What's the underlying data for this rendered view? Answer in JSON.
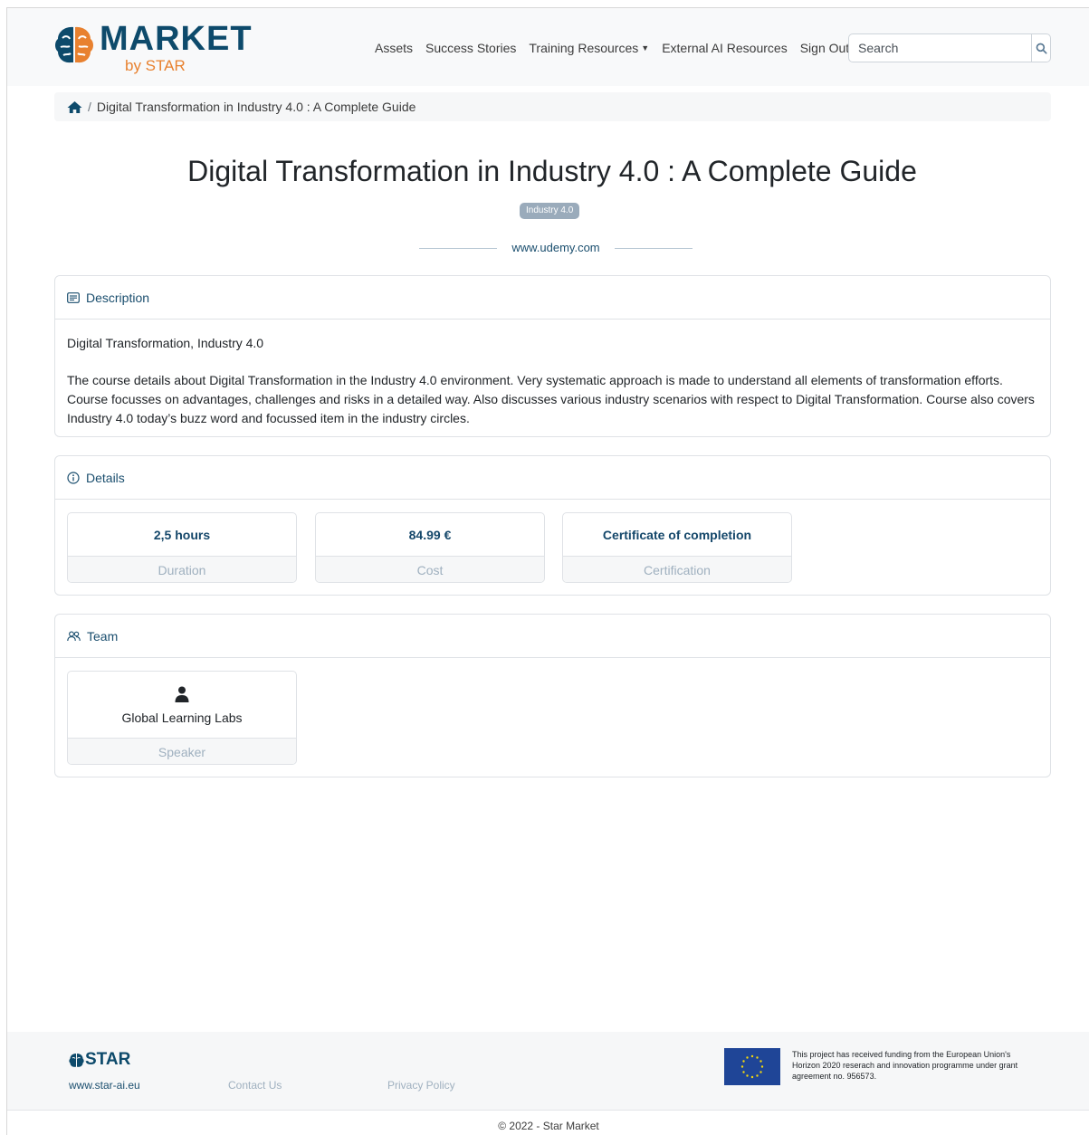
{
  "brand": {
    "logo_word": "MARKET",
    "logo_sub": "by STAR",
    "primary_color": "#0d4a6b",
    "accent_color": "#e8812f",
    "logo_icon": "brain-logo-icon"
  },
  "nav": {
    "items": [
      {
        "label": "Assets"
      },
      {
        "label": "Success Stories"
      },
      {
        "label": "Training Resources",
        "dropdown": true
      },
      {
        "label": "External AI Resources"
      },
      {
        "label": "Sign Out"
      }
    ],
    "search_placeholder": "Search",
    "search_icon": "search-icon"
  },
  "breadcrumb": {
    "home_icon": "home-icon",
    "separator": "/",
    "current": "Digital Transformation in Industry 4.0 : A Complete Guide"
  },
  "asset": {
    "title": "Digital Transformation in Industry 4.0 : A Complete Guide",
    "tag": "Industry 4.0",
    "source": "www.udemy.com"
  },
  "description": {
    "header": "Description",
    "keywords": "Digital Transformation, Industry 4.0",
    "text": "The course details about Digital Transformation in the Industry 4.0 environment. Very systematic approach is made to understand all elements of transformation efforts. Course focusses on advantages, challenges and risks in a detailed way. Also discusses various industry scenarios with respect to Digital Transformation. Course also covers Industry 4.0 today’s buzz word and focussed item in the industry circles."
  },
  "details": {
    "header": "Details",
    "items": [
      {
        "value": "2,5 hours",
        "label": "Duration"
      },
      {
        "value": "84.99 €",
        "label": "Cost"
      },
      {
        "value": "Certificate of completion",
        "label": "Certification"
      }
    ]
  },
  "team": {
    "header": "Team",
    "members": [
      {
        "name": "Global Learning Labs",
        "role": "Speaker",
        "icon": "person-icon"
      }
    ]
  },
  "footer": {
    "logo_word": "STAR",
    "site": "www.star-ai.eu",
    "contact": "Contact Us",
    "privacy": "Privacy Policy",
    "eu_text": "This project has received funding from the European Union's Horizon 2020 reserach and innovation programme under grant agreement no. 956573.",
    "copyright": "© 2022 - Star Market"
  }
}
